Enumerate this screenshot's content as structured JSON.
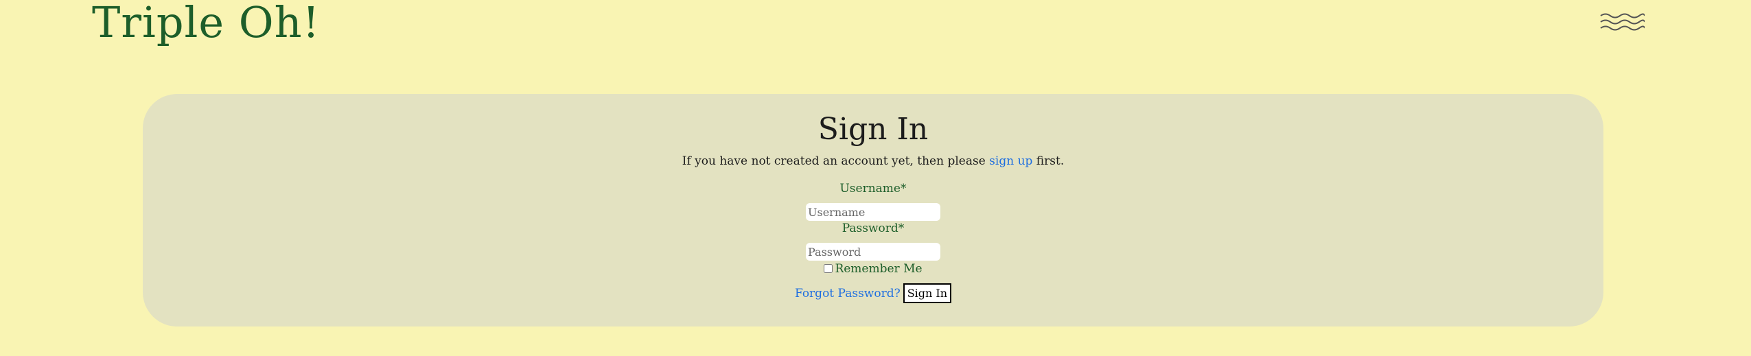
{
  "header": {
    "brand": "Triple Oh!",
    "menu_icon": "wavy-lines-menu-icon"
  },
  "signin": {
    "title": "Sign In",
    "intro_before": "If you have not created an account yet, then please ",
    "signup_link": "sign up",
    "intro_after": " first.",
    "username_label": "Username*",
    "username_placeholder": "Username",
    "username_value": "",
    "password_label": "Password*",
    "password_placeholder": "Password",
    "password_value": "",
    "remember_label": "Remember Me",
    "remember_checked": false,
    "forgot_link": "Forgot Password?",
    "submit_label": "Sign In"
  },
  "colors": {
    "page_background": "#f9f4b3",
    "card_background": "#e3e2c1",
    "brand_green": "#1d5e2a",
    "link_blue": "#1f6fe0"
  }
}
